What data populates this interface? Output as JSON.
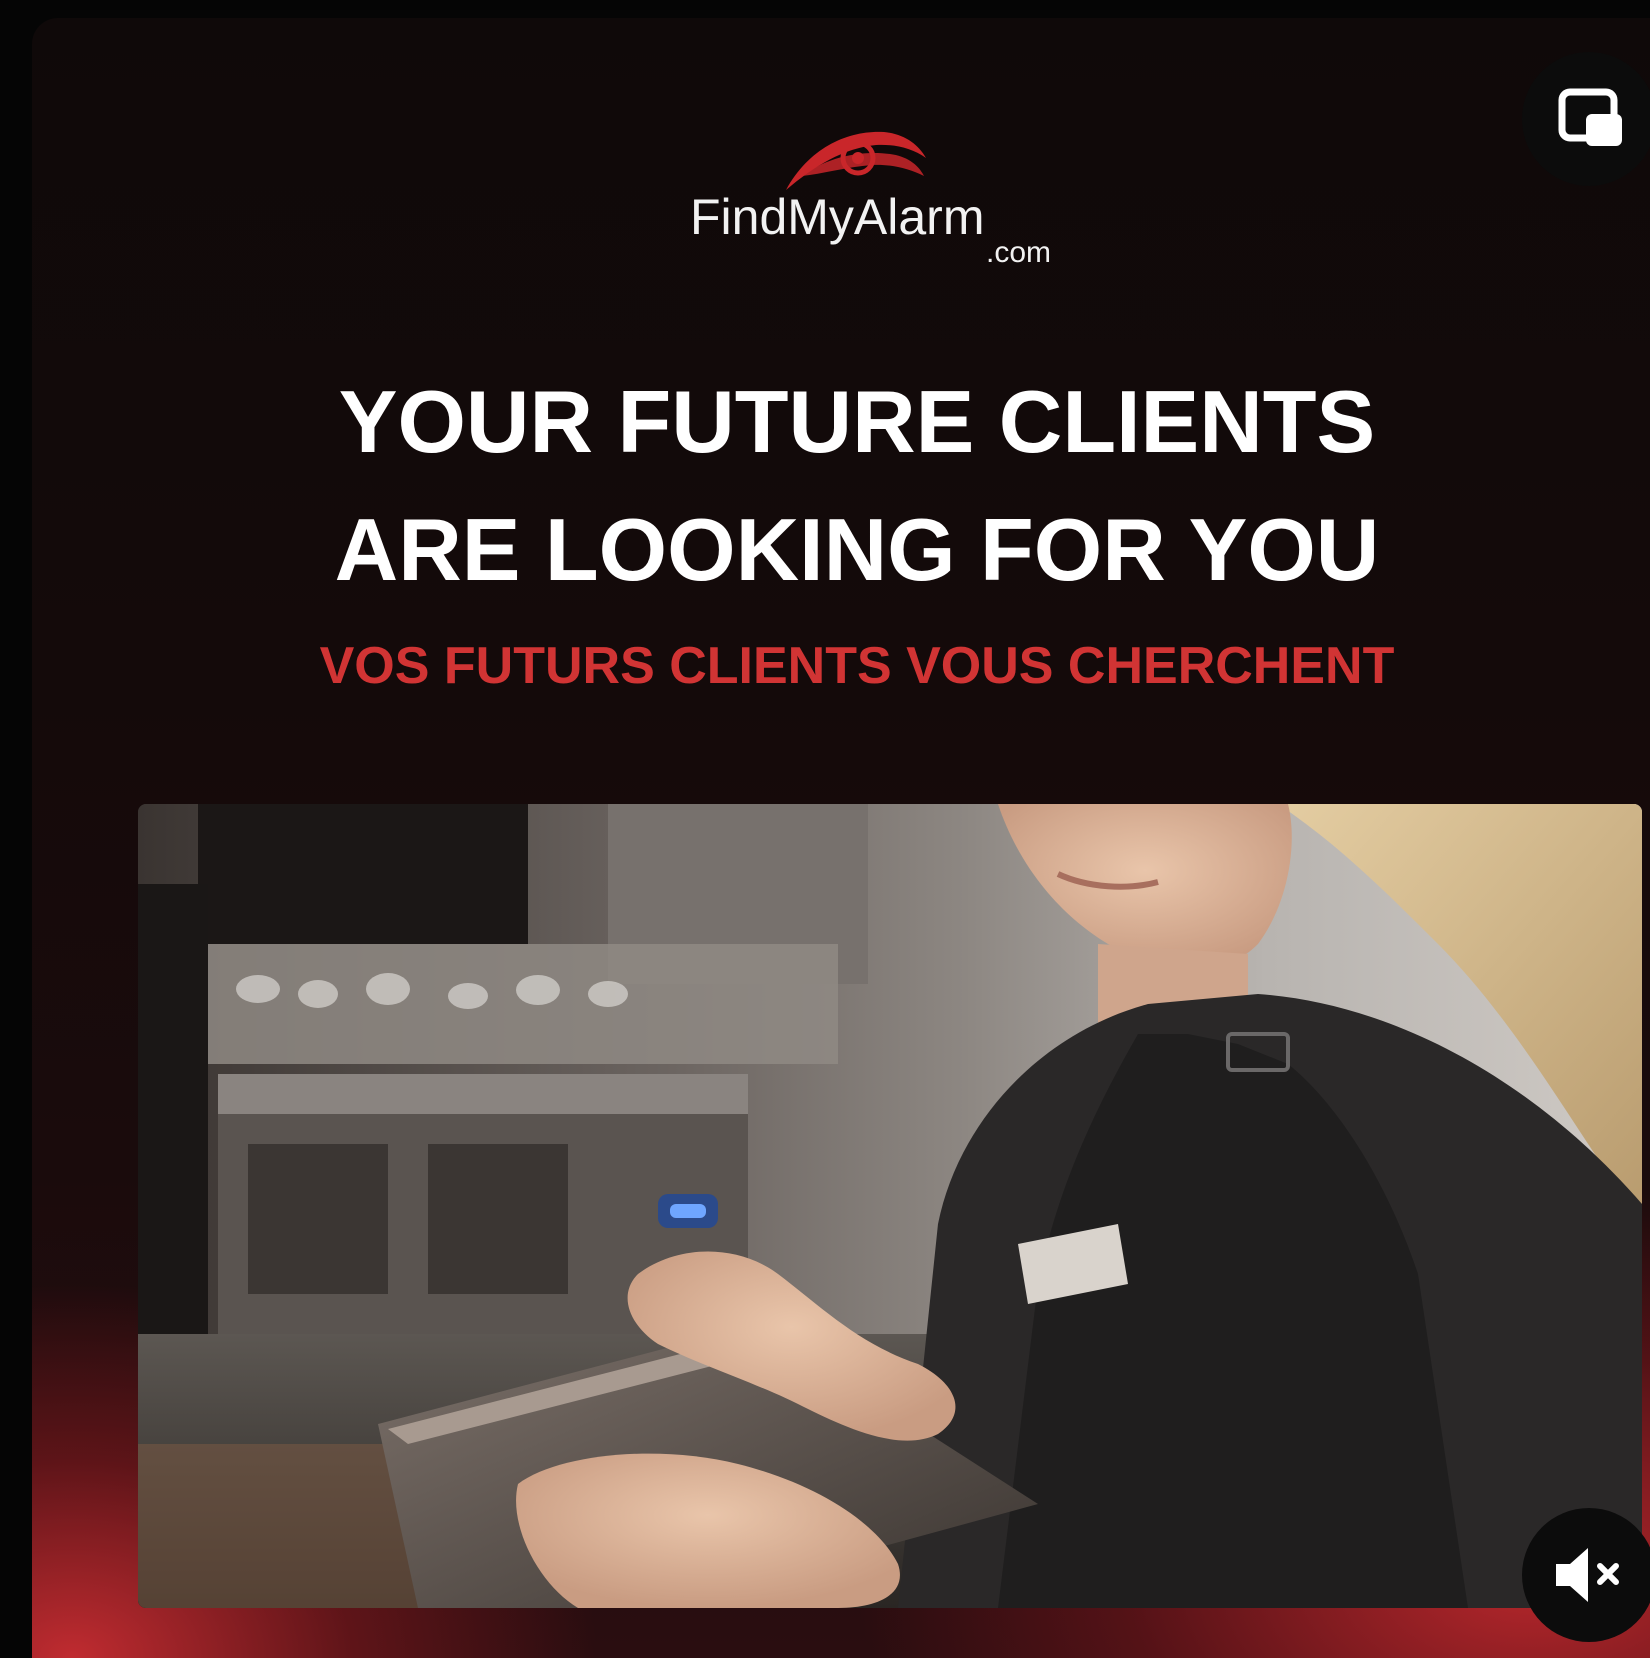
{
  "logo": {
    "name": "FindMyAlarm",
    "domain_suffix": ".com"
  },
  "headline": {
    "line1": "YOUR FUTURE CLIENTS",
    "line2": "ARE LOOKING FOR YOU"
  },
  "subheadline": "VOS FUTURS CLIENTS VOUS CHERCHENT",
  "controls": {
    "pip_icon": "picture-in-picture-icon",
    "mute_icon": "speaker-muted-icon"
  },
  "colors": {
    "brand_red": "#d13434",
    "logo_red": "#c9262a",
    "text_white": "#ffffff"
  }
}
